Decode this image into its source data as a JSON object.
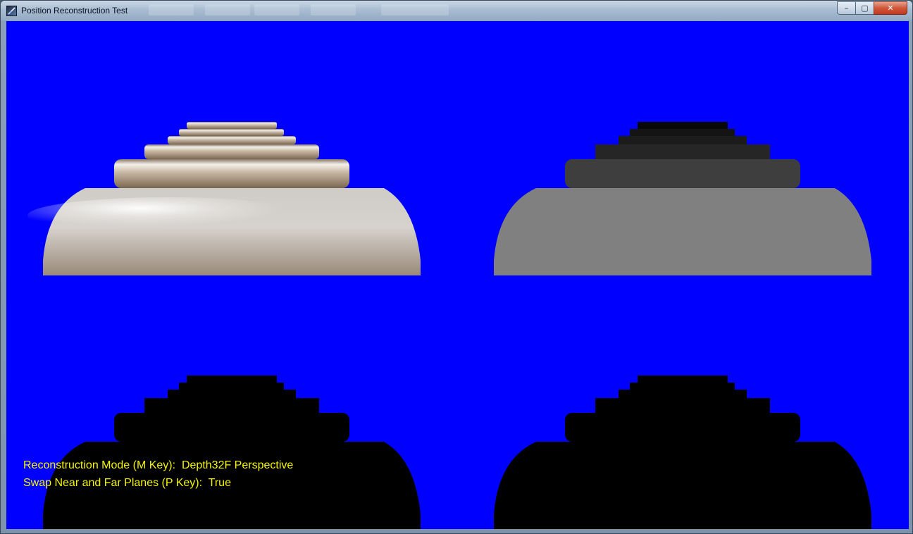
{
  "window": {
    "title": "Position Reconstruction Test",
    "controls": {
      "minimize": "–",
      "maximize": "▢",
      "close": "✕"
    }
  },
  "overlay": {
    "line1_label": "Reconstruction Mode (M Key):",
    "line1_value": "Depth32F Perspective",
    "line2_label": "Swap Near and Far Planes (P Key):",
    "line2_value": "True"
  },
  "colors": {
    "background": "#0000fe",
    "overlay_text": "#f5f500",
    "depth_gray": "#808080",
    "silhouette": "#000000"
  }
}
